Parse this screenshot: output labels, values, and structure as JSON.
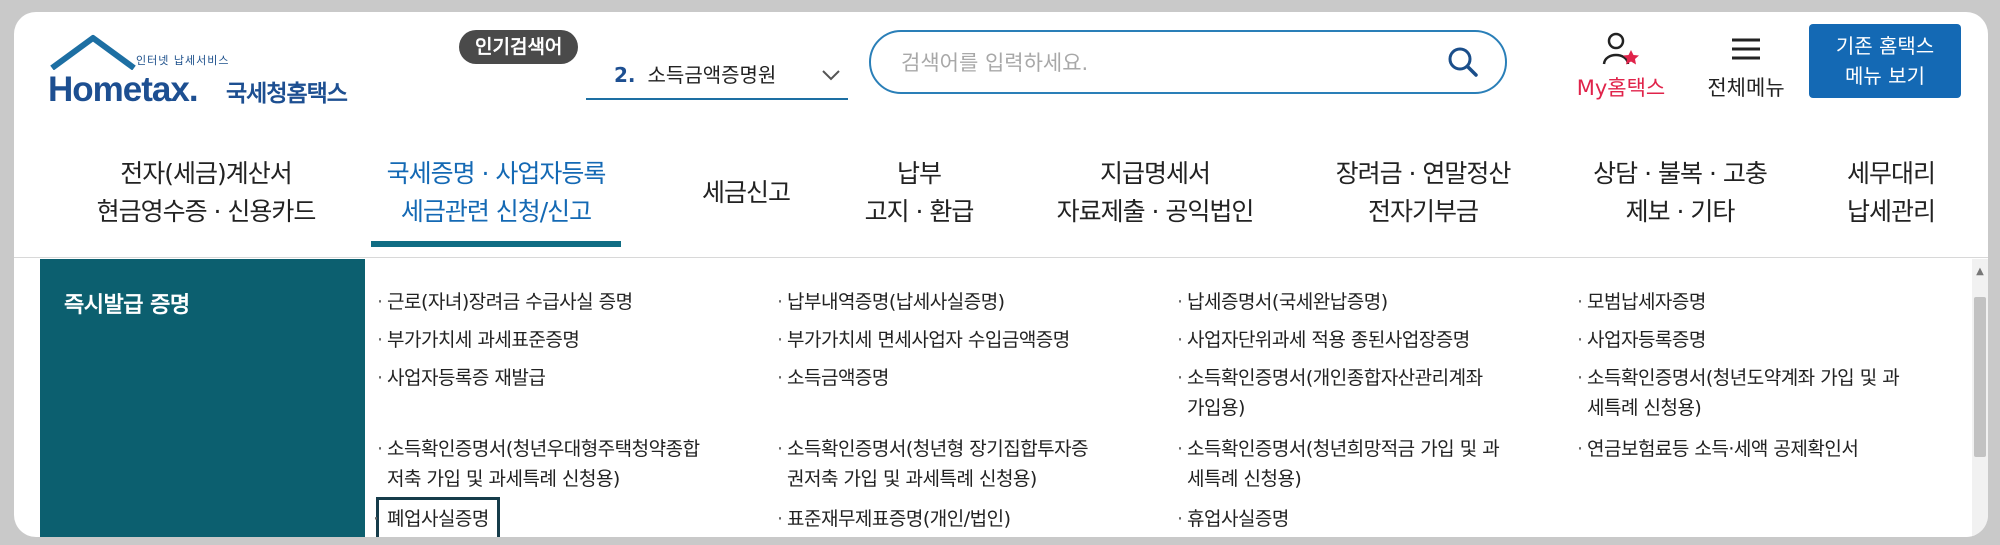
{
  "logo": {
    "small": "인터넷 납세서비스",
    "word": "Hometax.",
    "korean": "국세청홈택스"
  },
  "popular": {
    "badge": "인기검색어",
    "num": "2.",
    "item": "소득금액증명원"
  },
  "search": {
    "placeholder": "검색어를 입력하세요."
  },
  "utility": {
    "my": "My홈택스",
    "all_menu": "전체메뉴",
    "old_line1": "기존 홈택스",
    "old_line2": "메뉴 보기"
  },
  "nav": [
    {
      "line1": "전자(세금)계산서",
      "line2": "현금영수증 · 신용카드"
    },
    {
      "line1": "국세증명 · 사업자등록",
      "line2": "세금관련 신청/신고"
    },
    {
      "line1": "세금신고",
      "line2": ""
    },
    {
      "line1": "납부",
      "line2": "고지 · 환급"
    },
    {
      "line1": "지급명세서",
      "line2": "자료제출 · 공익법인"
    },
    {
      "line1": "장려금 · 연말정산",
      "line2": "전자기부금"
    },
    {
      "line1": "상담 · 불복 · 고충",
      "line2": "제보 · 기타"
    },
    {
      "line1": "세무대리",
      "line2": "납세관리"
    }
  ],
  "panel": {
    "title": "즉시발급 증명",
    "links": [
      [
        "근로(자녀)장려금 수급사실 증명",
        ""
      ],
      [
        "납부내역증명(납세사실증명)",
        ""
      ],
      [
        "납세증명서(국세완납증명)",
        ""
      ],
      [
        "모범납세자증명",
        ""
      ],
      [
        "부가가치세 과세표준증명",
        ""
      ],
      [
        "부가가치세 면세사업자 수입금액증명",
        ""
      ],
      [
        "사업자단위과세 적용 종된사업장증명",
        ""
      ],
      [
        "사업자등록증명",
        ""
      ],
      [
        "사업자등록증 재발급",
        ""
      ],
      [
        "소득금액증명",
        ""
      ],
      [
        "소득확인증명서(개인종합자산관리계좌",
        "가입용)"
      ],
      [
        "소득확인증명서(청년도약계좌 가입 및 과",
        "세특례 신청용)"
      ],
      [
        "소득확인증명서(청년우대형주택청약종합",
        "저축 가입 및 과세특례 신청용)"
      ],
      [
        "소득확인증명서(청년형 장기집합투자증",
        "권저축 가입 및 과세특례 신청용)"
      ],
      [
        "소득확인증명서(청년희망적금 가입 및 과",
        "세특례 신청용)"
      ],
      [
        "연금보험료등 소득·세액 공제확인서",
        ""
      ],
      [
        "폐업사실증명",
        ""
      ],
      [
        "표준재무제표증명(개인/법인)",
        ""
      ],
      [
        "휴업사실증명",
        ""
      ]
    ]
  }
}
